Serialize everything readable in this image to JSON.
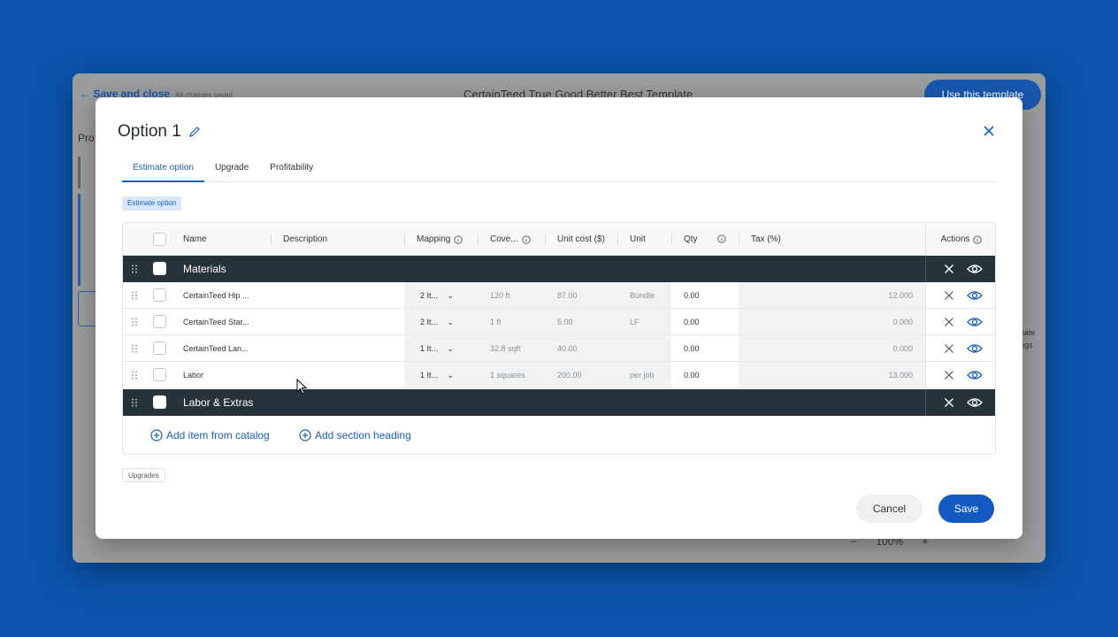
{
  "background": {
    "back_label": "Save and close",
    "saved_label": "All changes saved",
    "template_title": "CertainTeed True Good Better Best Template",
    "use_template": "Use this template",
    "side_label": "Pro",
    "right_label_1": "timate",
    "right_label_2": "ttings",
    "zoom_minus": "−",
    "zoom_value": "100%",
    "zoom_plus": "+"
  },
  "modal": {
    "title": "Option 1",
    "tabs": [
      {
        "label": "Estimate option",
        "active": true
      },
      {
        "label": "Upgrade",
        "active": false
      },
      {
        "label": "Profitability",
        "active": false
      }
    ],
    "estimate_chip": "Estimate option",
    "upgrades_chip": "Upgrades",
    "columns": {
      "name": "Name",
      "description": "Description",
      "mapping": "Mapping",
      "coverage": "Cove...",
      "unit_cost": "Unit cost ($)",
      "unit": "Unit",
      "qty": "Qty",
      "tax": "Tax (%)",
      "actions": "Actions"
    },
    "sections": [
      {
        "label": "Materials"
      },
      {
        "label": "Labor & Extras"
      }
    ],
    "rows": [
      {
        "name": "CertainTeed Hip ...",
        "mapping": "2 It...",
        "coverage": "120  ft",
        "unit_cost": "87.00",
        "unit": "Bundle",
        "qty": "0.00",
        "tax": "12.000"
      },
      {
        "name": "CertainTeed Star...",
        "mapping": "2 It...",
        "coverage": "1  ft",
        "unit_cost": "5.00",
        "unit": "LF",
        "qty": "0.00",
        "tax": "0.000"
      },
      {
        "name": "CertainTeed Lan...",
        "mapping": "1 It...",
        "coverage": "32.8  sqft",
        "unit_cost": "40.00",
        "unit": "",
        "qty": "0.00",
        "tax": "0.000"
      },
      {
        "name": "Labor",
        "mapping": "1 It...",
        "coverage": "1  squares",
        "unit_cost": "200.00",
        "unit": "per job",
        "qty": "0.00",
        "tax": "13.000"
      }
    ],
    "add_item": "Add item from catalog",
    "add_section": "Add section heading",
    "cancel": "Cancel",
    "save": "Save"
  },
  "colors": {
    "page_bg": "#0c54ad",
    "accent": "#1b5fb9",
    "section_bg": "#27333a",
    "save_bg": "#1458c2"
  }
}
